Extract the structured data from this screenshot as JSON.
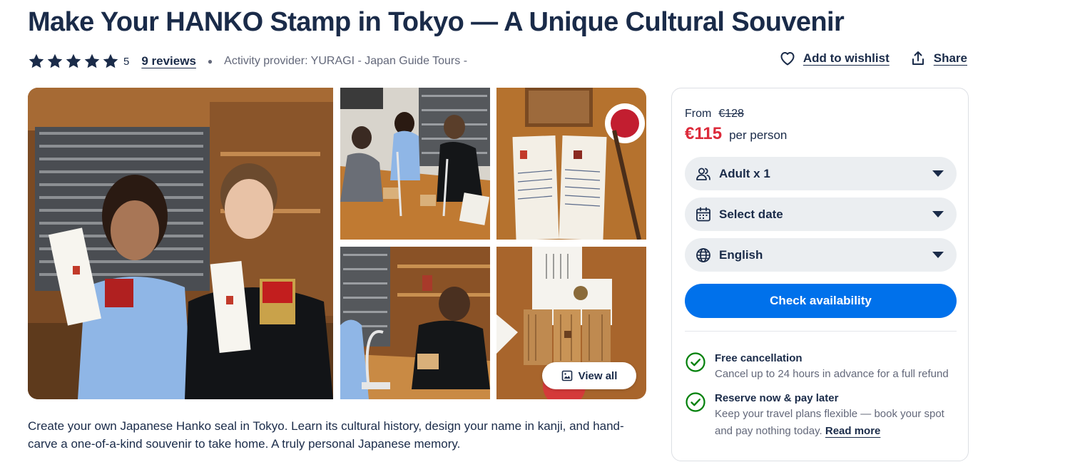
{
  "page": {
    "title": "Make Your HANKO Stamp in Tokyo — A Unique Cultural Souvenir"
  },
  "rating": {
    "stars": 5,
    "value": "5",
    "reviews_label": "9 reviews",
    "provider": "Activity provider: YURAGI - Japan Guide Tours -"
  },
  "actions": {
    "wishlist": "Add to wishlist",
    "share": "Share"
  },
  "gallery": {
    "view_all": "View all",
    "photos": [
      "main-photo",
      "workshop-photo",
      "hanko-cards-photo",
      "carving-photo",
      "finished-stamps-photo"
    ]
  },
  "description": "Create your own Japanese Hanko seal in Tokyo. Learn its cultural history, design your name in kanji, and hand-carve a one-of-a-kind souvenir to take home. A truly personal Japanese memory.",
  "booking": {
    "from_label": "From",
    "old_price": "€128",
    "price": "€115",
    "per_person": "per person",
    "participants": "Adult x 1",
    "date": "Select date",
    "language": "English",
    "cta": "Check availability",
    "features": [
      {
        "title": "Free cancellation",
        "text": "Cancel up to 24 hours in advance for a full refund"
      },
      {
        "title": "Reserve now & pay later",
        "text": "Keep your travel plans flexible — book your spot and pay nothing today.",
        "link": "Read more"
      }
    ]
  },
  "colors": {
    "navy": "#1a2b49",
    "price_red": "#dc2a3a",
    "cta_blue": "#0071eb",
    "check_green": "#008009",
    "select_bg": "#ebeef1"
  },
  "icons": [
    "star-icon",
    "heart-icon",
    "share-icon",
    "image-icon",
    "participants-icon",
    "calendar-icon",
    "globe-icon",
    "chevron-down-icon",
    "check-circle-icon"
  ]
}
